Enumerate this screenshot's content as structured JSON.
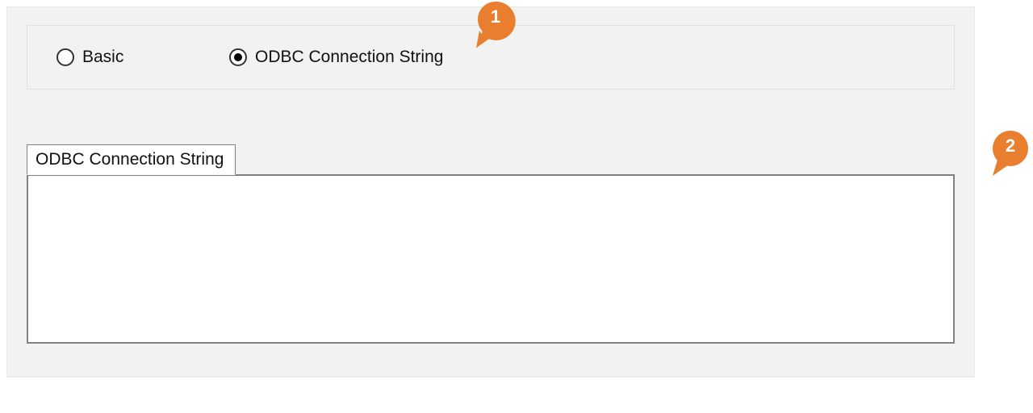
{
  "radios": {
    "basic": {
      "label": "Basic",
      "selected": false
    },
    "odbc": {
      "label": "ODBC Connection String",
      "selected": true
    }
  },
  "tab": {
    "label": "ODBC Connection String",
    "value": ""
  },
  "annotations": {
    "a1": "1",
    "a2": "2"
  },
  "colors": {
    "accent": "#e97e2e"
  }
}
